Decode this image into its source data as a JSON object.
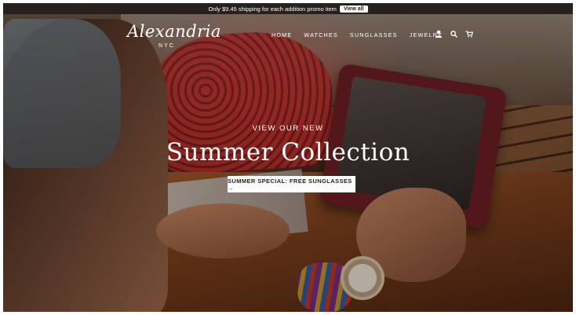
{
  "announcement": {
    "text": "Only $9.45 shipping for each addition promo item",
    "button_label": "View all"
  },
  "header": {
    "logo_text": "Alexandria",
    "logo_sub": "NYC",
    "nav": [
      {
        "label": "HOME"
      },
      {
        "label": "WATCHES"
      },
      {
        "label": "SUNGLASSES"
      },
      {
        "label": "JEWELRY"
      }
    ],
    "icons": {
      "account": "user-icon",
      "search": "search-icon",
      "cart": "cart-icon"
    }
  },
  "hero": {
    "kicker": "VIEW OUR NEW",
    "title": "Summer Collection",
    "button_label": "SUMMER SPECIAL: FREE SUNGLASSES →"
  },
  "colors": {
    "announcement_bg": "#231e1c",
    "text": "#ffffff",
    "button_bg": "#ffffff",
    "button_text": "#222222"
  }
}
